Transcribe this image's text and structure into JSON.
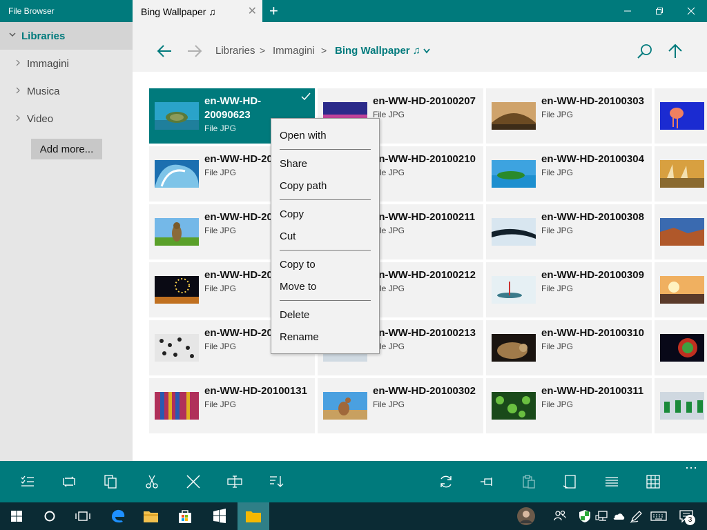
{
  "window": {
    "app_title": "File Browser",
    "tab_label": "Bing Wallpaper ♫",
    "new_tab_glyph": "+"
  },
  "sidebar": {
    "header": "Libraries",
    "items": [
      {
        "label": "Immagini"
      },
      {
        "label": "Musica"
      },
      {
        "label": "Video"
      }
    ],
    "add_more": "Add more..."
  },
  "breadcrumb": {
    "items": [
      "Libraries",
      "Immagini",
      "Bing Wallpaper ♫"
    ],
    "separator": ">"
  },
  "files": [
    {
      "name": "en-WW-HD-20090623",
      "type": "File JPG",
      "selected": true,
      "thumb": "turtle"
    },
    {
      "name": "en-WW-HD-20100207",
      "type": "File JPG",
      "thumb": "sky"
    },
    {
      "name": "en-WW-HD-20100303",
      "type": "File JPG",
      "thumb": "bridge"
    },
    {
      "name": "",
      "type": "",
      "thumb": "jellyfish"
    },
    {
      "name": "en-WW-HD-20",
      "type": "File JPG",
      "thumb": "wave"
    },
    {
      "name": "en-WW-HD-20100210",
      "type": "File JPG",
      "thumb": "sunset"
    },
    {
      "name": "en-WW-HD-20100304",
      "type": "File JPG",
      "thumb": "island"
    },
    {
      "name": "",
      "type": "",
      "thumb": "boats"
    },
    {
      "name": "en-WW-HD-20",
      "type": "File JPG",
      "thumb": "meerkat"
    },
    {
      "name": "en-WW-HD-20100211",
      "type": "File JPG",
      "thumb": "lake"
    },
    {
      "name": "en-WW-HD-20100308",
      "type": "File JPG",
      "thumb": "ice"
    },
    {
      "name": "",
      "type": "",
      "thumb": "canyon"
    },
    {
      "name": "en-WW-HD-20",
      "type": "File JPG",
      "thumb": "fireworks"
    },
    {
      "name": "en-WW-HD-20100212",
      "type": "File JPG",
      "thumb": "dusk"
    },
    {
      "name": "en-WW-HD-20100309",
      "type": "File JPG",
      "thumb": "boat-ice"
    },
    {
      "name": "",
      "type": "",
      "thumb": "coast"
    },
    {
      "name": "en-WW-HD-20",
      "type": "File JPG",
      "thumb": "penguins"
    },
    {
      "name": "en-WW-HD-20100213",
      "type": "File JPG",
      "thumb": "snow"
    },
    {
      "name": "en-WW-HD-20100310",
      "type": "File JPG",
      "thumb": "otter"
    },
    {
      "name": "",
      "type": "",
      "thumb": "nebula"
    },
    {
      "name": "en-WW-HD-20100131",
      "type": "File JPG",
      "thumb": "fabrics"
    },
    {
      "name": "en-WW-HD-20100302",
      "type": "File JPG",
      "thumb": "kangaroo"
    },
    {
      "name": "en-WW-HD-20100311",
      "type": "File JPG",
      "thumb": "leaves"
    },
    {
      "name": "",
      "type": "",
      "thumb": "dancers"
    }
  ],
  "context_menu": {
    "open_with": "Open with",
    "share": "Share",
    "copy_path": "Copy path",
    "copy": "Copy",
    "cut": "Cut",
    "copy_to": "Copy to",
    "move_to": "Move to",
    "delete": "Delete",
    "rename": "Rename"
  },
  "command_bar": {
    "more": "⋯"
  },
  "taskbar": {
    "notification_count": "3"
  },
  "colors": {
    "accent": "#007a7c",
    "taskbar": "#0b2b34"
  }
}
